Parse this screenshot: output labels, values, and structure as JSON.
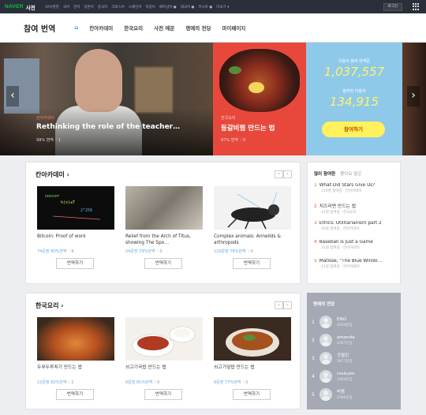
{
  "topbar": {
    "logo": "NAVER",
    "logo_sub": "사전",
    "nav_items": [
      "국어/영영",
      "국어",
      "한자",
      "일본어",
      "중국어",
      "크로스어",
      "스페인어",
      "독일어",
      "베트남어 ●",
      "태국어 ●",
      "러시아 ●",
      "더보기 ▾"
    ],
    "login": "로그인"
  },
  "header": {
    "title": "참여 번역",
    "nav": [
      "칸아카데미",
      "한국요리",
      "사전 예문",
      "명예의 전당",
      "마이페이지"
    ]
  },
  "hero": {
    "slide1": {
      "tag": "칸아카데미",
      "title": "Rethinking the role of the teacher…",
      "meta": "99% 번역  ♡1"
    },
    "slide2": {
      "tag": "한국요리",
      "title": "등갈비찜 만드는 법",
      "meta": "87% 번역  ♡0"
    },
    "slide3": {
      "label1": "이용자 참여 번역문",
      "count1": "1,037,557",
      "label2": "참여한 이용자",
      "count2": "134,915",
      "button": "참여하기"
    }
  },
  "khan": {
    "title": "칸아카데미",
    "cards": [
      {
        "title": "Bitcoin: Proof of work",
        "pct": "74문장 80%번역",
        "likes": "♡6",
        "button": "번역하기"
      },
      {
        "title": "Relief from the Arch of Titus, showing The Spo…",
        "pct": "24문장 79%번역",
        "likes": "♡0",
        "button": "번역하기"
      },
      {
        "title": "Complex animals: Annelids & arthropods",
        "pct": "120문장 78%번역",
        "likes": "♡0",
        "button": "번역하기"
      }
    ]
  },
  "korean": {
    "title": "한국요리",
    "cards": [
      {
        "title": "두부두루치기 만드는 법",
        "pct": "12문장 82%번역",
        "likes": "♡2",
        "button": "번역하기"
      },
      {
        "title": "쇠고기국밥 만드는 법",
        "pct": "6문장 81%번역",
        "likes": "♡0",
        "button": "번역하기"
      },
      {
        "title": "쇠고기덮밥 만드는 법",
        "pct": "9문장 77%번역",
        "likes": "♡0",
        "button": "번역하기"
      }
    ]
  },
  "popular": {
    "tab_on": "많이 참여한",
    "tab_off": "좋아요 많은",
    "items": [
      {
        "n": "1",
        "title": "What Did Stars Give Us?",
        "sub": "119명 참여중 · 칸아카데미"
      },
      {
        "n": "2",
        "title": "치즈라면 만드는 법",
        "sub": "41명 참여중 · 한국요리"
      },
      {
        "n": "3",
        "title": "Ethics: Utilitarianism part 2",
        "sub": "35명 참여중 · 칸아카데미"
      },
      {
        "n": "4",
        "title": "Baseball is Just a Game",
        "sub": "31명 참여중 · 칸아카데미"
      },
      {
        "n": "5",
        "title": "Matisse, \"The Blue Windo…",
        "sub": "21명 참여중 · 칸아카데미"
      }
    ]
  },
  "hall": {
    "title": "명예의 전당",
    "users": [
      {
        "n": "1",
        "name": "ENO",
        "count": "9244문장"
      },
      {
        "n": "2",
        "name": "amanda",
        "count": "4267문장"
      },
      {
        "n": "3",
        "name": "굿월린",
        "count": "3977문장"
      },
      {
        "n": "4",
        "name": "roxluum",
        "count": "3364문장"
      },
      {
        "n": "5",
        "name": "비뭄",
        "count": "2580문장"
      }
    ]
  },
  "colors": {
    "accent": "#00c73c",
    "hero_red": "#e8483c",
    "hero_blue": "#8fc9ea",
    "highlight": "#fff36b"
  }
}
